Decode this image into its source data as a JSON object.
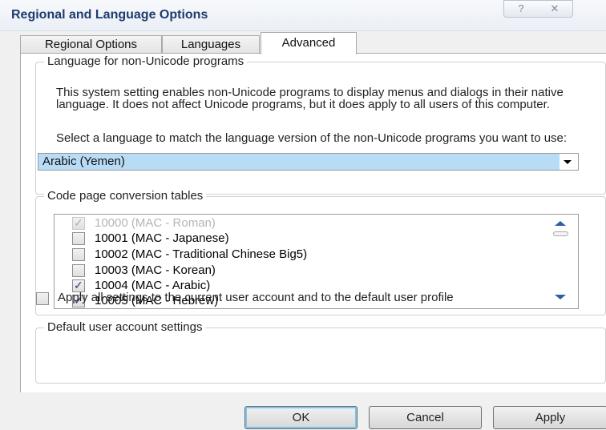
{
  "window": {
    "title": "Regional and Language Options",
    "help_glyph": "?",
    "close_glyph": "✕"
  },
  "tabs": [
    {
      "label": "Regional Options",
      "active": false
    },
    {
      "label": "Languages",
      "active": false
    },
    {
      "label": "Advanced",
      "active": true
    }
  ],
  "non_unicode": {
    "group_label": "Language for non-Unicode programs",
    "description": "This system setting enables non-Unicode programs to display menus and dialogs in their native language. It does not affect Unicode programs, but it does apply to all users of this computer.",
    "select_prompt": "Select a language to match the language version of the non-Unicode programs you want to use:",
    "selected_language": "Arabic (Yemen)"
  },
  "code_pages": {
    "group_label": "Code page conversion tables",
    "items": [
      {
        "label": "10000 (MAC - Roman)",
        "checked": true,
        "disabled": true
      },
      {
        "label": "10001 (MAC - Japanese)",
        "checked": false,
        "disabled": false
      },
      {
        "label": "10002 (MAC - Traditional Chinese Big5)",
        "checked": false,
        "disabled": false
      },
      {
        "label": "10003 (MAC - Korean)",
        "checked": false,
        "disabled": false
      },
      {
        "label": "10004 (MAC - Arabic)",
        "checked": true,
        "disabled": false
      },
      {
        "label": "10005 (MAC - Hebrew)",
        "checked": true,
        "disabled": false
      }
    ]
  },
  "default_account": {
    "group_label": "Default user account settings",
    "checkbox_label": "Apply all settings to the current user account and to the default user profile",
    "checked": false
  },
  "buttons": {
    "ok": "OK",
    "cancel": "Cancel",
    "apply": "Apply"
  },
  "glyphs": {
    "check": "✓"
  },
  "colors": {
    "title_text": "#1e3b6c",
    "selection_bg": "#b8dcf5",
    "default_button_glow": "#7fc3ed"
  }
}
